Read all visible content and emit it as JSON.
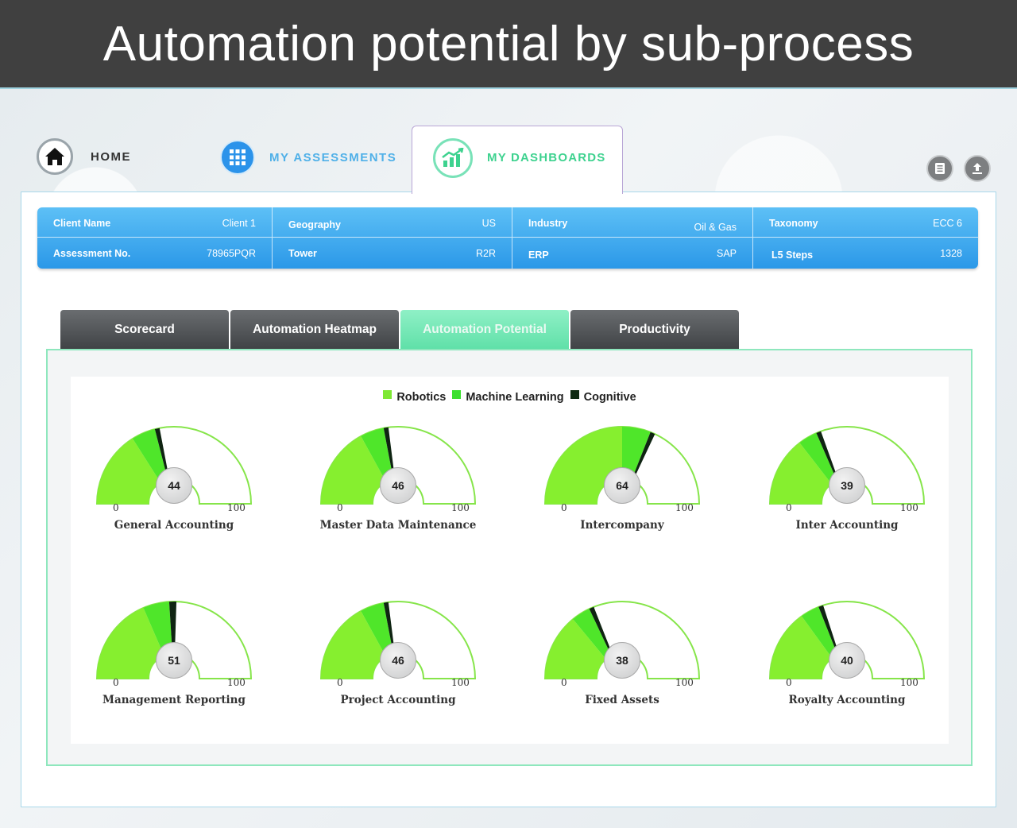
{
  "page_title": "Automation potential by sub-process",
  "nav": {
    "home": "HOME",
    "assessments": "MY ASSESSMENTS",
    "dashboards": "MY DASHBOARDS"
  },
  "info_rows": [
    [
      {
        "key": "Client Name",
        "value": "Client 1"
      },
      {
        "key": "Geography",
        "value": "US"
      },
      {
        "key": "Industry",
        "value": "Oil & Gas"
      },
      {
        "key": "Taxonomy",
        "value": "ECC 6"
      }
    ],
    [
      {
        "key": "Assessment No.",
        "value": "78965PQR"
      },
      {
        "key": "Tower",
        "value": "R2R"
      },
      {
        "key": "ERP",
        "value": "SAP"
      },
      {
        "key": "L5 Steps",
        "value": "1328"
      }
    ]
  ],
  "tabs": [
    {
      "label": "Scorecard",
      "active": false
    },
    {
      "label": "Automation Heatmap",
      "active": false
    },
    {
      "label": "Automation Potential",
      "active": true
    },
    {
      "label": "Productivity",
      "active": false
    }
  ],
  "legend": [
    {
      "label": "Robotics",
      "color": "#7ee834"
    },
    {
      "label": "Machine Learning",
      "color": "#3be02f"
    },
    {
      "label": "Cognitive",
      "color": "#0e2a12"
    }
  ],
  "colors": {
    "robotics": "#86ef2f",
    "machine_learning": "#4fe62a",
    "cognitive": "#0f2412",
    "gauge_outline": "#86e54a"
  },
  "gauge_scale": {
    "min": "0",
    "max": "100"
  },
  "gauges": [
    {
      "name": "General Accounting",
      "value": 44,
      "robotics": 32,
      "machine_learning": 10,
      "cognitive": 2
    },
    {
      "name": "Master Data Maintenance",
      "value": 46,
      "robotics": 34,
      "machine_learning": 10,
      "cognitive": 2
    },
    {
      "name": "Intercompany",
      "value": 64,
      "robotics": 50,
      "machine_learning": 12,
      "cognitive": 2
    },
    {
      "name": "Inter Accounting",
      "value": 39,
      "robotics": 29,
      "machine_learning": 8,
      "cognitive": 2
    },
    {
      "name": "Management Reporting",
      "value": 51,
      "robotics": 37,
      "machine_learning": 11,
      "cognitive": 3
    },
    {
      "name": "Project Accounting",
      "value": 46,
      "robotics": 34,
      "machine_learning": 10,
      "cognitive": 2
    },
    {
      "name": "Fixed Assets",
      "value": 38,
      "robotics": 28,
      "machine_learning": 8,
      "cognitive": 2
    },
    {
      "name": "Royalty Accounting",
      "value": 40,
      "robotics": 30,
      "machine_learning": 8,
      "cognitive": 2
    }
  ]
}
